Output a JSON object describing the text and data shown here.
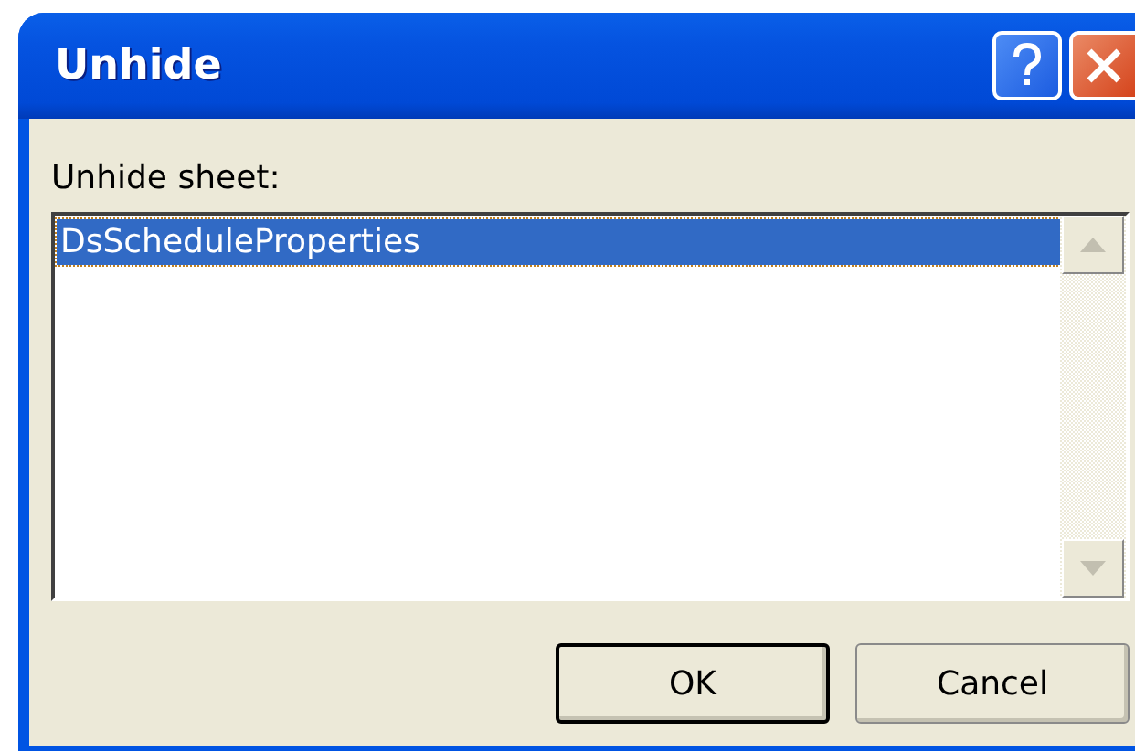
{
  "window": {
    "title": "Unhide"
  },
  "prompt": "Unhide sheet:",
  "sheets": [
    {
      "name": "DsScheduleProperties",
      "selected": true
    }
  ],
  "buttons": [
    {
      "label": "OK",
      "default": true
    },
    {
      "label": "Cancel",
      "default": false
    }
  ]
}
